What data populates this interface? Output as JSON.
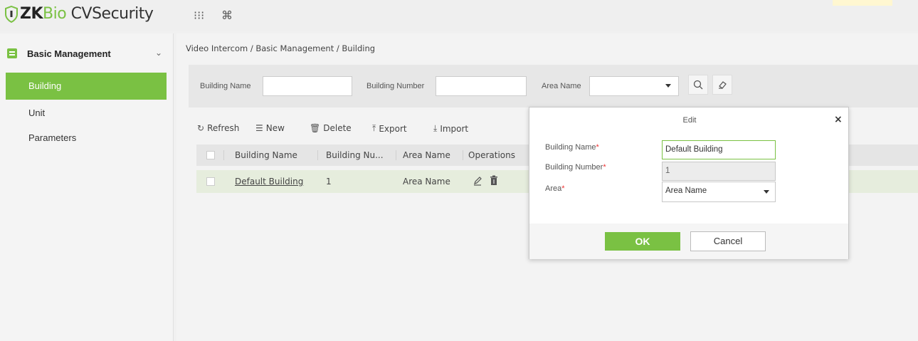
{
  "app": {
    "logo_zk": "ZK",
    "logo_bio": "Bio",
    "logo_rest": " CVSecurity",
    "grid_icon": "⁝⁝⁝",
    "cmd_icon": "⌘"
  },
  "sidebar": {
    "header_label": "Basic Management",
    "chevron": "⌄",
    "items": [
      {
        "label": "Building"
      },
      {
        "label": "Unit"
      },
      {
        "label": "Parameters"
      }
    ]
  },
  "breadcrumb": "Video Intercom / Basic Management / Building",
  "search": {
    "building_name_label": "Building Name",
    "building_number_label": "Building Number",
    "area_name_label": "Area Name",
    "search_icon": "🔍",
    "clear_icon": "◇"
  },
  "toolbar": {
    "refresh": "Refresh",
    "new": "New",
    "delete": "Delete",
    "export": "Export",
    "import": "Import"
  },
  "table": {
    "columns": [
      "Building Name",
      "Building Nu...",
      "Area Name",
      "Operations"
    ],
    "rows": [
      {
        "building_name": "Default Building",
        "building_number": "1",
        "area_name": "Area Name"
      }
    ]
  },
  "modal": {
    "title": "Edit",
    "close": "×",
    "building_name_label": "Building Name",
    "building_number_label": "Building Number",
    "area_label": "Area",
    "required": "*",
    "building_name_value": "Default Building",
    "building_number_value": "1",
    "area_value": "Area Name",
    "ok": "OK",
    "cancel": "Cancel"
  },
  "colors": {
    "accent": "#7ac143"
  }
}
